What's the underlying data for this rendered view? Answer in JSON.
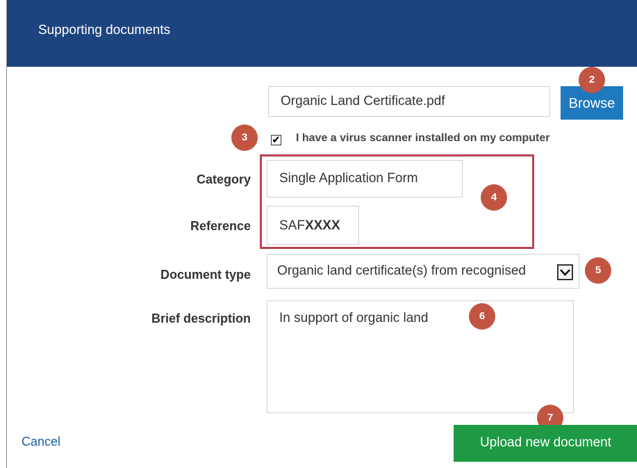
{
  "dialog": {
    "title": "Supporting documents"
  },
  "file": {
    "value": "Organic Land Certificate.pdf",
    "browse_label": "Browse"
  },
  "virus_check": {
    "checked": true,
    "check_mark": "✔",
    "label": "I have a virus scanner installed on my computer"
  },
  "category": {
    "label": "Category",
    "value": "Single Application Form"
  },
  "reference": {
    "label": "Reference",
    "prefix": "SAF",
    "suffix": "XXXX"
  },
  "document_type": {
    "label": "Document type",
    "selected": "Organic land certificate(s) from recognised"
  },
  "description": {
    "label": "Brief description",
    "value": "In support of organic land"
  },
  "actions": {
    "cancel_label": "Cancel",
    "upload_label": "Upload new document"
  },
  "badges": [
    "2",
    "3",
    "4",
    "5",
    "6",
    "7"
  ],
  "colors": {
    "header": "#1e4480",
    "browse": "#1f79be",
    "upload": "#1d9a43",
    "badge": "#c25442",
    "highlight": "#b84450"
  }
}
